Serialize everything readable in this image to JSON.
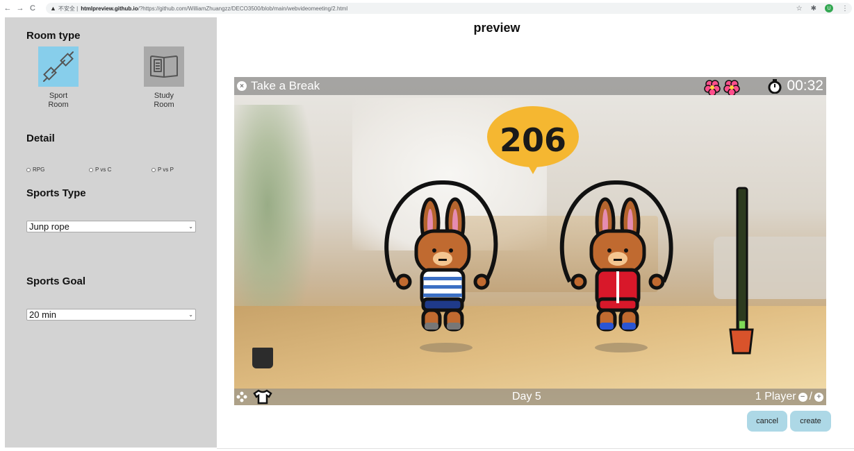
{
  "browser": {
    "back": "←",
    "forward": "→",
    "reload": "C",
    "warning": "▲",
    "insecure": "不安全 |",
    "host": "htmlpreview.github.io",
    "path": "/?https://github.com/WilliamZhuangzz/DECO3500/blob/main/webvideomeeting/2.html",
    "star": "☆",
    "ext": "✱",
    "profile": "U",
    "menu": "⋮"
  },
  "sidebar": {
    "room_type_title": "Room type",
    "rooms": [
      {
        "label_line1": "Sport",
        "label_line2": "Room",
        "selected": true
      },
      {
        "label_line1": "Study",
        "label_line2": "Room",
        "selected": false
      }
    ],
    "detail_title": "Detail",
    "detail_options": [
      "RPG",
      "P vs C",
      "P vs P"
    ],
    "sports_type_title": "Sports Type",
    "sports_type_value": "Junp rope",
    "sports_goal_title": "Sports Goal",
    "sports_goal_value": "20 min",
    "chevron": "⌄"
  },
  "main": {
    "preview_title": "preview",
    "game": {
      "break_label": "Take a Break",
      "timer": "00:32",
      "counter": "206",
      "day": "Day 5",
      "players": "1 Player",
      "slash": "/",
      "minus": "−",
      "plus": "+",
      "x": "×",
      "meter_level": 0.08
    },
    "cancel_label": "cancel",
    "create_label": "create"
  },
  "colors": {
    "sidebar_bg": "#d3d3d3",
    "sport_tile": "#87ceeb",
    "study_tile": "#a9a9a9",
    "button_bg": "#add8e6",
    "bubble": "#f5b731"
  }
}
